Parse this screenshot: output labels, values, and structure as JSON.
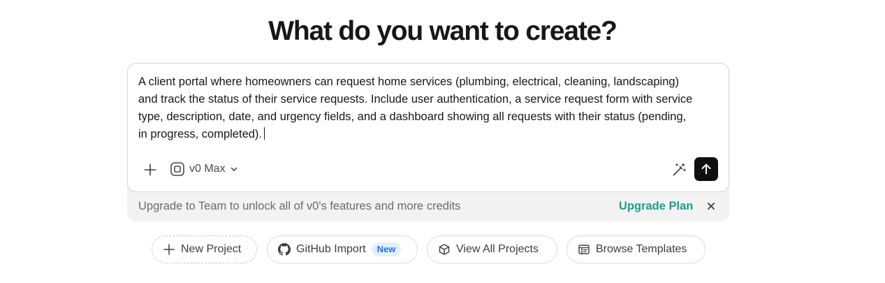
{
  "heading": "What do you want to create?",
  "composer": {
    "prompt_value": "A client portal where homeowners can request home services (plumbing, electrical, cleaning, landscaping) and track the status of their service requests. Include user authentication, a service request form with service type, description, date, and urgency fields, and a dashboard showing all requests with their status (pending, in progress, completed).",
    "model_label": "v0 Max",
    "icons": {
      "attach": "plus-icon",
      "model": "model-chip-icon",
      "model_dropdown": "chevron-down-icon",
      "enhance": "magic-wand-icon",
      "send": "arrow-up-icon"
    }
  },
  "upgrade_banner": {
    "text": "Upgrade to Team to unlock all of v0's features and more credits",
    "link_label": "Upgrade Plan",
    "accent_color": "#1a9e8f",
    "dismiss_icon": "close-icon"
  },
  "quick_actions": [
    {
      "label": "New Project",
      "icon": "plus-icon"
    },
    {
      "label": "GitHub Import",
      "icon": "github-icon",
      "badge": "New"
    },
    {
      "label": "View All Projects",
      "icon": "cube-icon"
    },
    {
      "label": "Browse Templates",
      "icon": "template-icon"
    }
  ]
}
